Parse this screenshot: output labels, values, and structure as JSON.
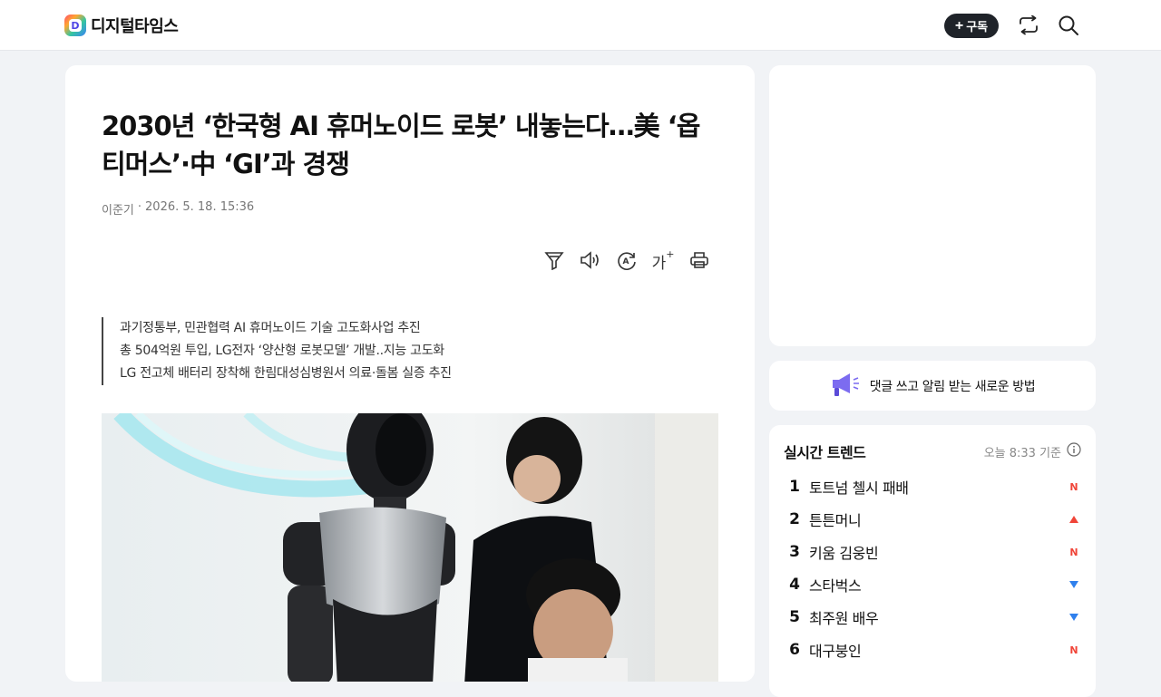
{
  "header": {
    "brand_logo_letter": "D",
    "brand_name": "디지털타임스",
    "subscribe_label": "구독",
    "icons": [
      "share-icon",
      "search-icon"
    ]
  },
  "article": {
    "headline": "2030년 ‘한국형 AI 휴머노이드 로봇’ 내놓는다…美 ‘옵티머스’·中 ‘GI’과 경쟁",
    "author": "이준기",
    "separator": "·",
    "datetime": "2026. 5. 18. 15:36",
    "tools": [
      "filter-icon",
      "speaker-icon",
      "translate-icon",
      "font-size-icon",
      "print-icon"
    ],
    "font_size_glyph": "가",
    "translate_glyph": "A",
    "summary": [
      "과기정통부, 민관협력 AI 휴머노이드 기술 고도화사업 추진",
      "총 504억원 투입, LG전자 ‘양산형 로봇모델’ 개발..지능 고도화",
      "LG 전고체 배터리 장착해 한림대성심병원서 의료·돌봄 실증 추진"
    ]
  },
  "sidebar": {
    "notice_text": "댓글 쓰고 알림 받는 새로운 방법",
    "trends": {
      "title": "실시간 트렌드",
      "updated": "오늘 8:33 기준",
      "items": [
        {
          "rank": "1",
          "label": "토트넘 첼시 패배",
          "status": "new"
        },
        {
          "rank": "2",
          "label": "튼튼머니",
          "status": "up"
        },
        {
          "rank": "3",
          "label": "키움 김웅빈",
          "status": "new"
        },
        {
          "rank": "4",
          "label": "스타벅스",
          "status": "down"
        },
        {
          "rank": "5",
          "label": "최주원 배우",
          "status": "down"
        },
        {
          "rank": "6",
          "label": "대구붕인",
          "status": "new"
        }
      ],
      "new_mark": "N"
    }
  },
  "colors": {
    "new": "#f04438",
    "up": "#f04438",
    "down": "#2f80ed",
    "accent": "#4f46e5"
  }
}
